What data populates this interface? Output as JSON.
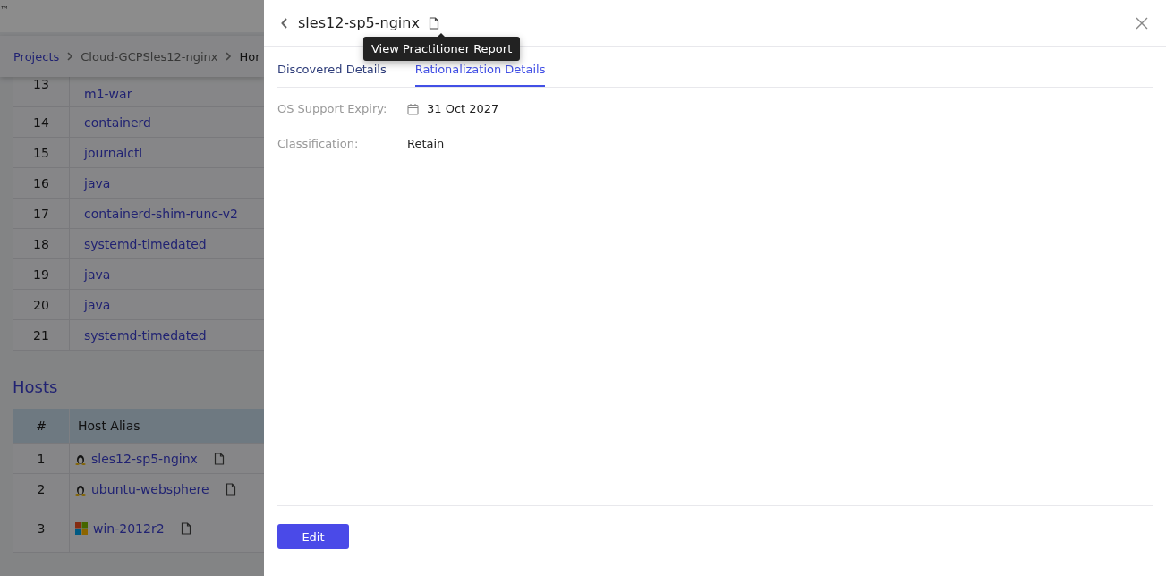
{
  "background": {
    "brand": "™",
    "breadcrumb": [
      {
        "label": "Projects",
        "kind": "link"
      },
      {
        "label": "Cloud-GCPSles12-nginx",
        "kind": "plain"
      },
      {
        "label": "Hor",
        "kind": "current"
      }
    ],
    "process_rows": [
      {
        "index": "13",
        "name": "m1-war"
      },
      {
        "index": "14",
        "name": "containerd"
      },
      {
        "index": "15",
        "name": "journalctl"
      },
      {
        "index": "16",
        "name": "java"
      },
      {
        "index": "17",
        "name": "containerd-shim-runc-v2"
      },
      {
        "index": "18",
        "name": "systemd-timedated"
      },
      {
        "index": "19",
        "name": "java"
      },
      {
        "index": "20",
        "name": "java"
      },
      {
        "index": "21",
        "name": "systemd-timedated"
      }
    ],
    "hosts": {
      "title": "Hosts",
      "columns": [
        "#",
        "Host Alias"
      ],
      "rows": [
        {
          "index": "1",
          "kind": "linux",
          "alias": "sles12-sp5-nginx"
        },
        {
          "index": "2",
          "kind": "linux",
          "alias": "ubuntu-websphere"
        },
        {
          "index": "3",
          "kind": "windows",
          "alias": "win-2012r2"
        }
      ]
    }
  },
  "drawer": {
    "title": "sles12-sp5-nginx",
    "tooltip": "View Practitioner Report",
    "tabs": [
      {
        "label": "Discovered Details",
        "selected": false
      },
      {
        "label": "Rationalization Details",
        "selected": true
      }
    ],
    "fields": [
      {
        "label": "OS Support Expiry:",
        "value": "31 Oct 2027",
        "kind": "date"
      },
      {
        "label": "Classification:",
        "value": "Retain",
        "kind": "text"
      }
    ],
    "edit_button": "Edit"
  }
}
